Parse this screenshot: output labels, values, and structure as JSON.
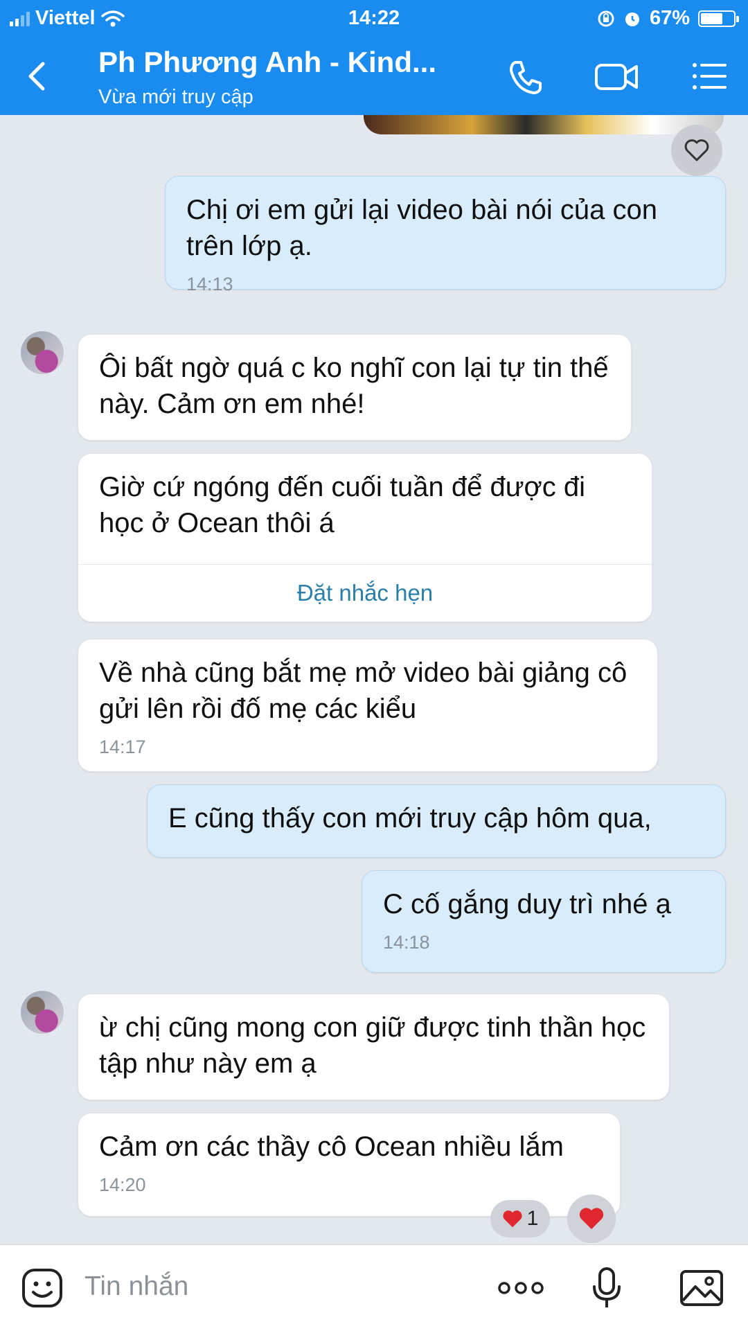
{
  "status": {
    "carrier": "Viettel",
    "time": "14:22",
    "battery": "67%",
    "battery_level": 0.67
  },
  "header": {
    "title": "Ph Phương Anh - Kind...",
    "subtitle": "Vừa mới truy cập"
  },
  "messages": [
    {
      "text": "Chị ơi em gửi lại video bài nói của con trên lớp ạ.",
      "time": "14:13"
    },
    {
      "text": "Ôi bất ngờ quá c ko nghĩ con lại tự tin thế này. Cảm ơn em nhé!"
    },
    {
      "text": "Giờ cứ ngóng đến cuối tuần để được đi học ở Ocean thôi á",
      "action": "Đặt nhắc hẹn"
    },
    {
      "text": "Về nhà cũng bắt mẹ mở video bài giảng cô gửi lên rồi đố mẹ các kiểu",
      "time": "14:17"
    },
    {
      "text": "E cũng thấy con mới truy cập hôm qua,"
    },
    {
      "text": "C cố gắng duy trì nhé ạ",
      "time": "14:18"
    },
    {
      "text": "ừ chị cũng mong con giữ được tinh thần học tập như này em ạ"
    },
    {
      "text": "Cảm ơn các thầy cô Ocean nhiều lắm",
      "time": "14:20",
      "reaction_count": "1"
    }
  ],
  "input": {
    "placeholder": "Tin nhắn"
  },
  "colors": {
    "header": "#1a8cf0",
    "bubble_out": "#d8ecfc",
    "bubble_in": "#ffffff",
    "background": "#e3e7ee",
    "heart": "#e0262f",
    "reminder_link": "#2a7fa8"
  },
  "icons": [
    "back-icon",
    "phone-icon",
    "video-call-icon",
    "menu-icon",
    "heart-icon",
    "sticker-icon",
    "more-icon",
    "microphone-icon",
    "image-icon"
  ]
}
